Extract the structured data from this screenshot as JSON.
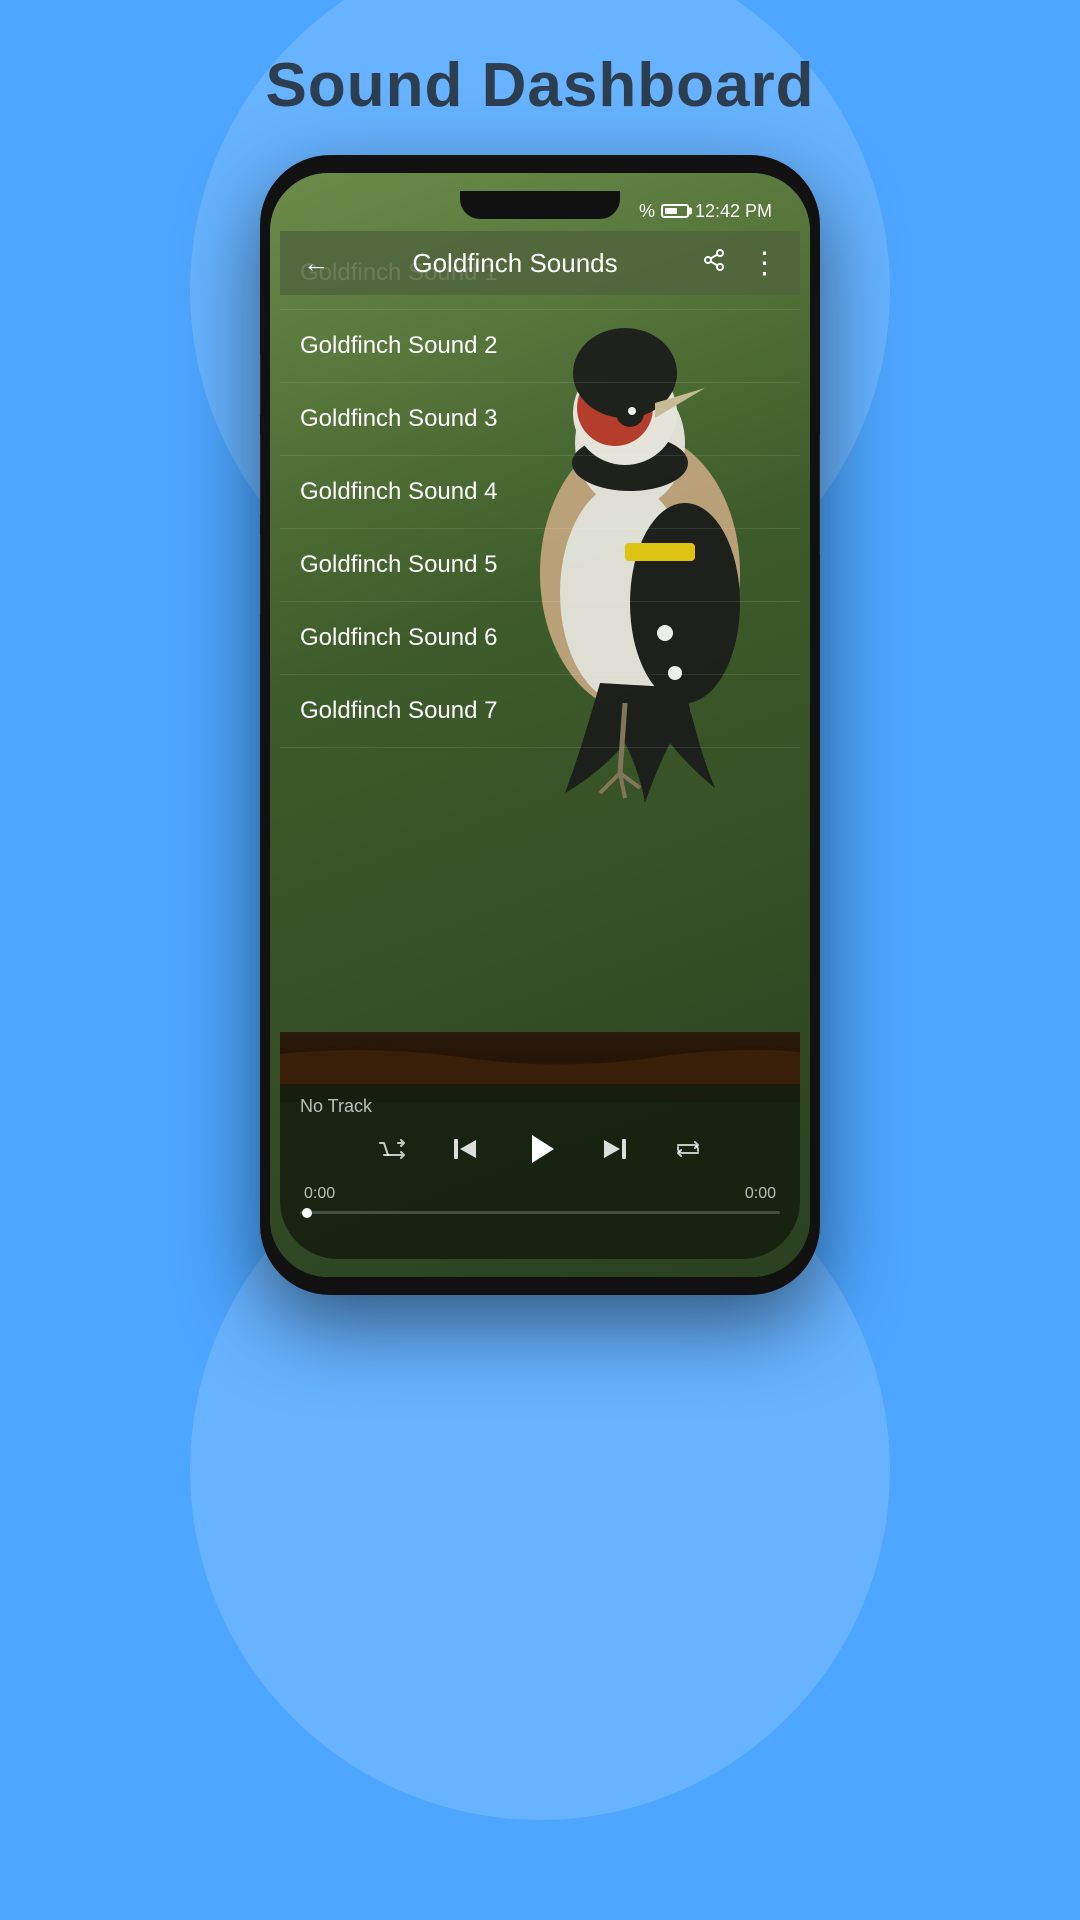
{
  "page": {
    "title": "Sound Dashboard",
    "background_color": "#4da6ff"
  },
  "status_bar": {
    "signal": "%",
    "battery": "Battery",
    "time": "12:42 PM"
  },
  "app_bar": {
    "title": "Goldfinch Sounds",
    "back_icon": "←",
    "share_icon": "share",
    "menu_icon": "⋮"
  },
  "sound_list": {
    "items": [
      {
        "id": 1,
        "label": "Goldfinch Sound 1"
      },
      {
        "id": 2,
        "label": "Goldfinch Sound 2"
      },
      {
        "id": 3,
        "label": "Goldfinch Sound 3"
      },
      {
        "id": 4,
        "label": "Goldfinch Sound 4"
      },
      {
        "id": 5,
        "label": "Goldfinch Sound 5"
      },
      {
        "id": 6,
        "label": "Goldfinch Sound 6"
      },
      {
        "id": 7,
        "label": "Goldfinch Sound 7"
      }
    ]
  },
  "player": {
    "no_track_label": "No Track",
    "time_start": "0:00",
    "time_end": "0:00",
    "shuffle_icon": "shuffle",
    "prev_icon": "prev",
    "play_icon": "play",
    "next_icon": "next",
    "repeat_icon": "repeat"
  }
}
